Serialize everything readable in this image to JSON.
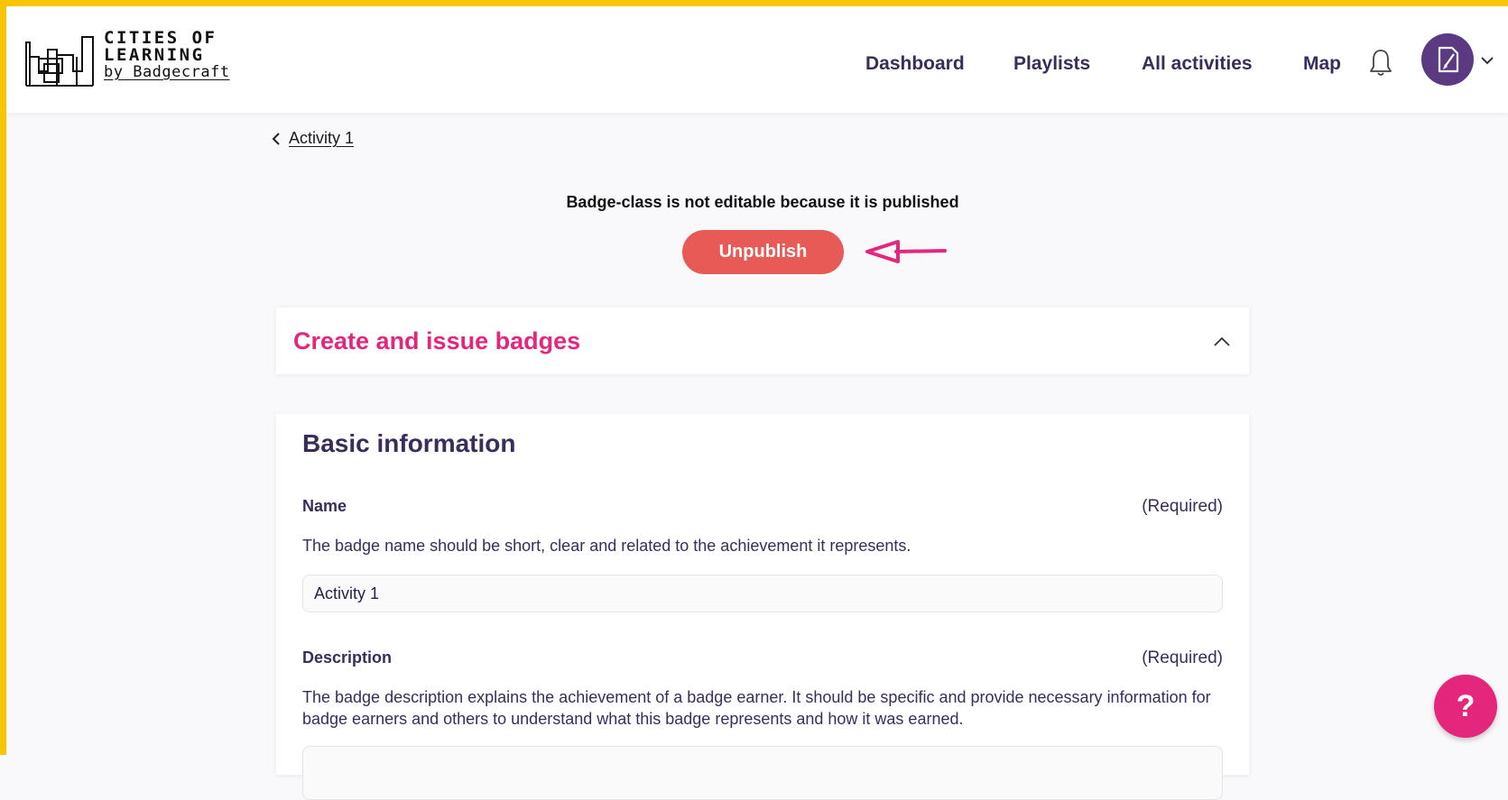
{
  "logo": {
    "line1": "CITIES OF",
    "line2": "LEARNING",
    "line3": "by Badgecraft"
  },
  "nav": {
    "items": [
      "Dashboard",
      "Playlists",
      "All activities",
      "Map"
    ]
  },
  "breadcrumb": {
    "back_label": "Activity 1"
  },
  "notice": {
    "text": "Badge-class is not editable because it is published",
    "button_label": "Unpublish"
  },
  "section": {
    "title": "Create and issue badges"
  },
  "basic_info": {
    "title": "Basic information",
    "name": {
      "label": "Name",
      "required": "(Required)",
      "help": "The badge name should be short, clear and related to the achievement it represents.",
      "value": "Activity 1"
    },
    "description": {
      "label": "Description",
      "required": "(Required)",
      "help": "The badge description explains the achievement of a badge earner. It should be specific and provide necessary information for badge earners and others to understand what this badge represents and how it was earned."
    }
  },
  "help_button": {
    "label": "?"
  },
  "colors": {
    "frame": "#f7c600",
    "accent_pink": "#e4267d",
    "unpublish_red": "#e85a55",
    "avatar_purple": "#5b3a82",
    "text_dark_purple": "#3a2d5c"
  },
  "icons": [
    "logo-icon",
    "bell-icon",
    "avatar-icon",
    "chevron-down-icon",
    "chevron-left-icon",
    "arrow-annotation-icon",
    "chevron-up-icon",
    "help-icon"
  ]
}
